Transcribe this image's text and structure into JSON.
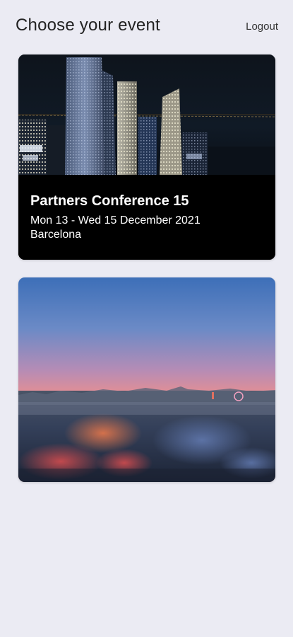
{
  "header": {
    "title": "Choose your event",
    "logout_label": "Logout"
  },
  "events": [
    {
      "title": "Partners Conference 15",
      "dates": "Mon 13 - Wed 15 December 2021",
      "location": "Barcelona",
      "image": "city-skyline-night-photo"
    },
    {
      "image": "city-sunset-panorama-photo"
    }
  ],
  "colors": {
    "background": "#ebebf3",
    "card_info_background": "#000000",
    "title_text": "#222222",
    "card_text": "#ffffff"
  }
}
